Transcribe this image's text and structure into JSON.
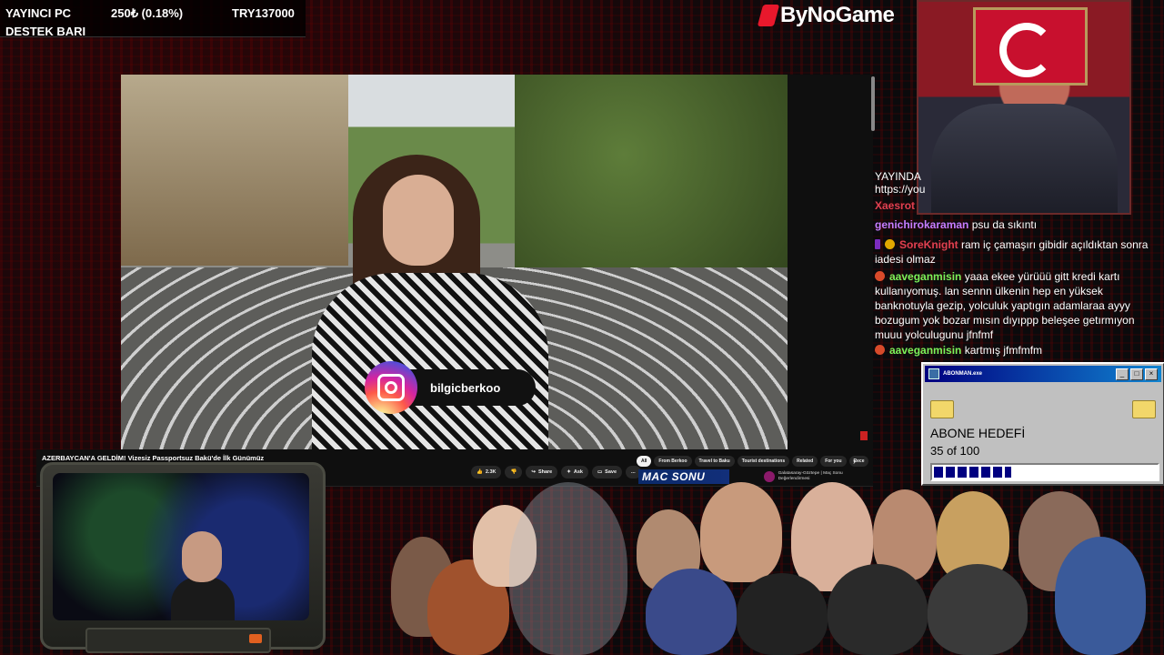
{
  "support_bar": {
    "line1": "YAYINCI PC",
    "line2": "DESTEK BARI",
    "amount": "250₺ (0.18%)",
    "goal": "TRY137000"
  },
  "logo": {
    "text": "ByNoGame"
  },
  "chat": {
    "messages": [
      {
        "user": "",
        "text": "YAYINDA",
        "user_color": "#ffffff"
      },
      {
        "user": "",
        "text": "https://you",
        "user_color": "#ffffff"
      },
      {
        "user": "Xaesrot",
        "text": "",
        "user_color": "#e04050"
      },
      {
        "user": "genichirokaraman",
        "text": "psu da sıkıntı",
        "user_color": "#c77dff"
      },
      {
        "user": "SoreKnight",
        "text": "ram iç çamaşırı gibidir açıldıktan sonra iadesi olmaz",
        "user_color": "#e04050"
      },
      {
        "user": "aaveganmisin",
        "text": "yaaa ekee yürüüü gitt kredi kartı kullanıyomuş. lan sennn ülkenin hep en yüksek banknotuyla gezip, yolculuk yaptıgın adamlaraa ayyy bozugum yok bozar mısın dıyıppp beleşee getırmıyon muuu yolculugunu jfnfmf",
        "user_color": "#7cf25a"
      },
      {
        "user": "aaveganmisin",
        "text": "kartmış jfmfmfm",
        "user_color": "#7cf25a"
      }
    ]
  },
  "video": {
    "instagram_handle": "bilgicberkoo",
    "title": "AZERBAYCAN'A GELDİM! Vizesiz Passportsuz Bakü'de İlk Günümüz",
    "likes": "2.3K",
    "share_label": "Share",
    "ask_label": "Ask",
    "save_label": "Save",
    "more_label": "...",
    "filters": [
      "All",
      "From Berkoo",
      "Travel to Baku",
      "Tourist destinations",
      "Related",
      "For you",
      "Rece"
    ],
    "rec_thumb_text": "MAC SONU",
    "rec_title": "Galatasaray-Göztepe | Maç Sonu Değerlendirmesi"
  },
  "goal_widget": {
    "window_title": "ABONMAN.exe",
    "label": "ABONE HEDEFİ",
    "count_text": "35 of 100",
    "progress": 0.35
  },
  "colors": {
    "accent_red": "#e8182c",
    "win_title": "#000080"
  }
}
